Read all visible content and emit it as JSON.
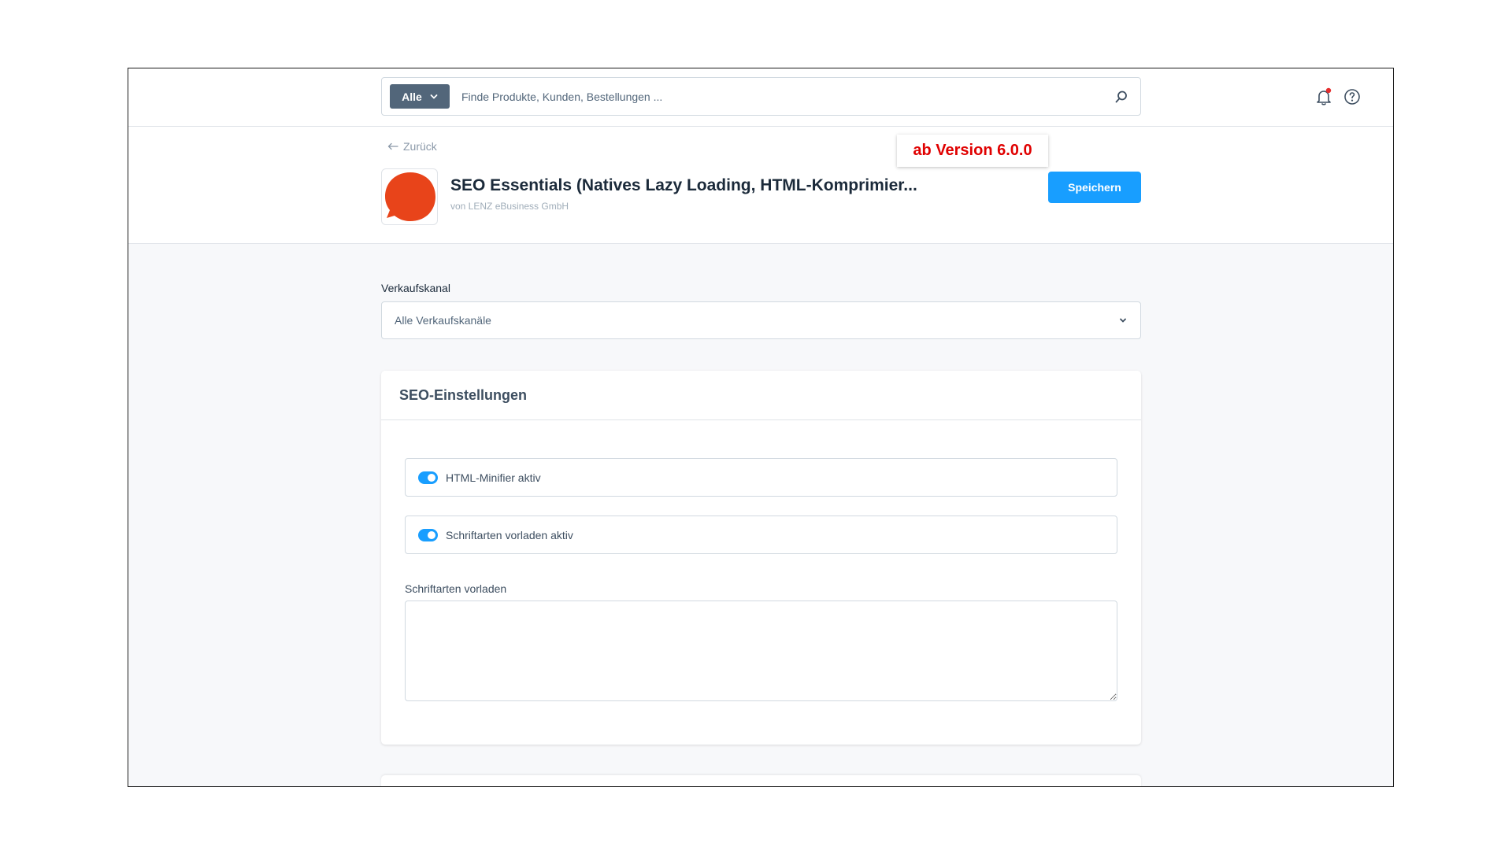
{
  "search": {
    "type_label": "Alle",
    "placeholder": "Finde Produkte, Kunden, Bestellungen ..."
  },
  "header": {
    "back_label": "Zurück",
    "version_badge": "ab Version 6.0.0",
    "plugin_title": "SEO Essentials (Natives Lazy Loading, HTML-Komprimier...",
    "plugin_author": "von LENZ eBusiness GmbH",
    "save_label": "Speichern"
  },
  "sales_channel": {
    "label": "Verkaufskanal",
    "selected": "Alle Verkaufskanäle"
  },
  "card": {
    "title": "SEO-Einstellungen",
    "toggles": [
      {
        "label": "HTML-Minifier aktiv",
        "enabled": true
      },
      {
        "label": "Schriftarten vorladen aktiv",
        "enabled": true
      }
    ],
    "textarea_label": "Schriftarten vorladen",
    "textarea_value": ""
  },
  "colors": {
    "accent": "#189eff",
    "badge_text": "#e00000",
    "logo": "#e8441a",
    "notification_dot": "#e52d2d"
  },
  "icons": [
    "chevron-down-icon",
    "search-icon",
    "bell-icon",
    "help-icon",
    "arrow-left-icon",
    "plugin-logo"
  ]
}
